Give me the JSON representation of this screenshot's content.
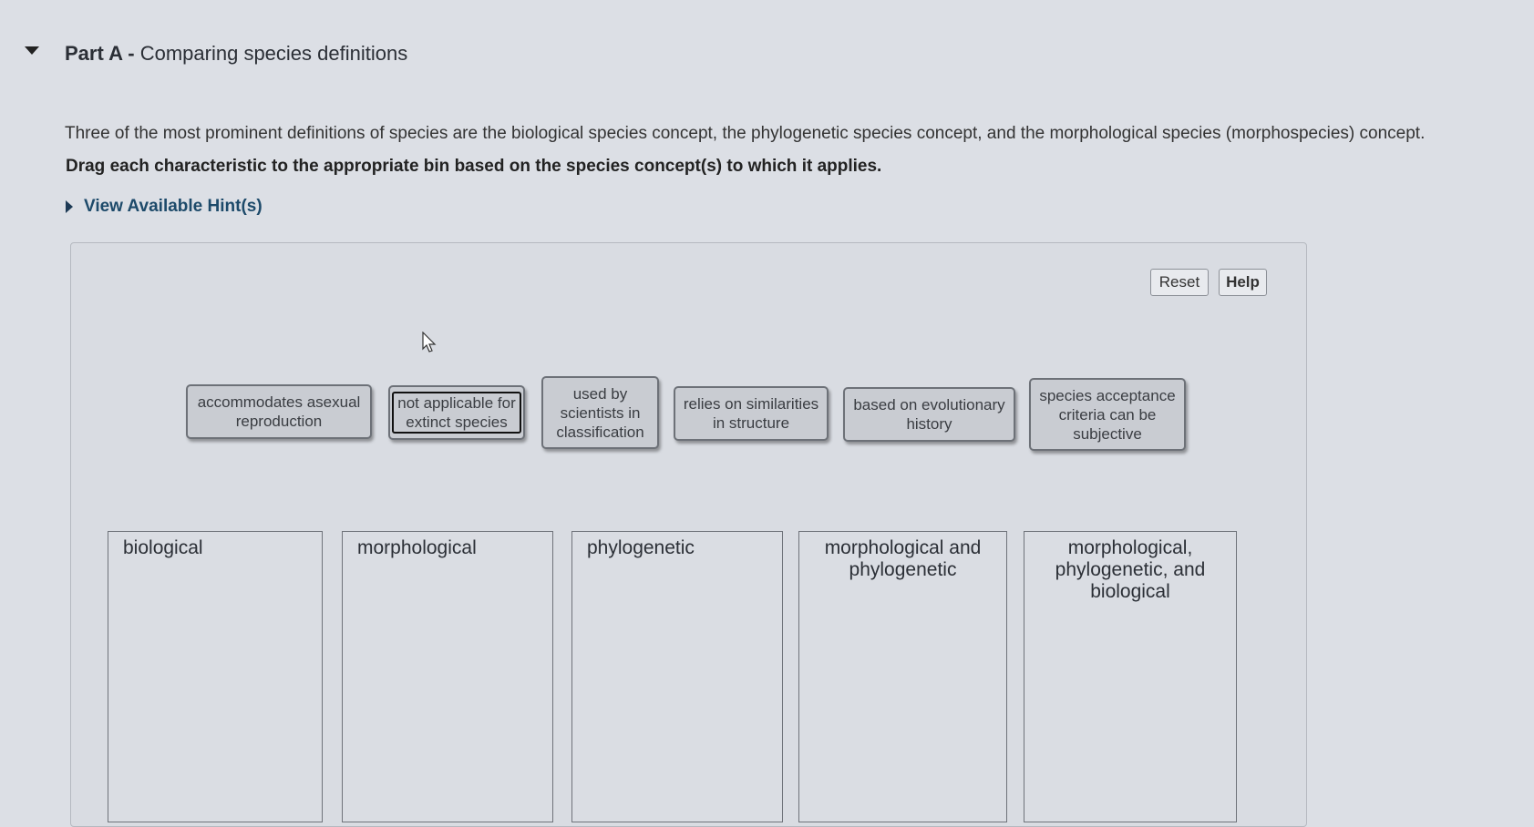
{
  "part": {
    "label": "Part A",
    "separator": " - ",
    "title": "Comparing species definitions"
  },
  "intro": "Three of the most prominent definitions of species are the biological species concept, the phylogenetic species concept, and the morphological species (morphospecies) concept.",
  "instruction": "Drag each characteristic to the appropriate bin based on the species concept(s) to which it applies.",
  "hint_label": "View Available Hint(s)",
  "toolbar": {
    "reset": "Reset",
    "help": "Help"
  },
  "chips": [
    "accommodates asexual reproduction",
    "not applicable for extinct species",
    "used by scientists in classification",
    "relies on similarities in structure",
    "based on evolutionary history",
    "species acceptance criteria can be subjective"
  ],
  "bins": [
    "biological",
    "morphological",
    "phylogenetic",
    "morphological and phylogenetic",
    "morphological, phylogenetic, and biological"
  ]
}
